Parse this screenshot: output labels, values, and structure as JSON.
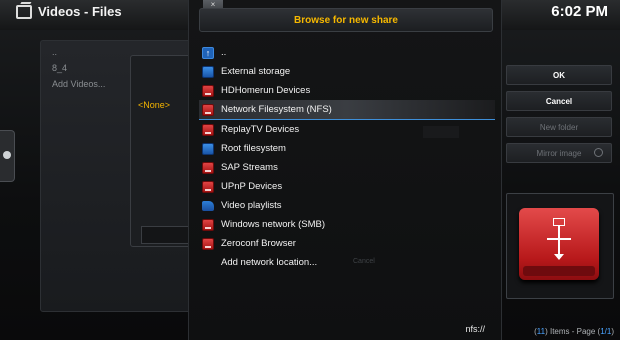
{
  "window": {
    "title": "Videos - Files",
    "clock": "6:02 PM"
  },
  "background_list": {
    "items": [
      "..",
      "8_4",
      "Add Videos..."
    ],
    "selected_value": "<None>"
  },
  "dialog": {
    "close_glyph": "×",
    "title": "Browse for new share",
    "items": [
      {
        "label": "..",
        "icon": "up-arrow-icon"
      },
      {
        "label": "External storage",
        "icon": "hard-drive-blue-icon"
      },
      {
        "label": "HDHomerun Devices",
        "icon": "network-drive-icon"
      },
      {
        "label": "Network Filesystem (NFS)",
        "icon": "network-drive-icon",
        "selected": true
      },
      {
        "label": "ReplayTV Devices",
        "icon": "network-drive-icon"
      },
      {
        "label": "Root filesystem",
        "icon": "hard-drive-blue-icon"
      },
      {
        "label": "SAP Streams",
        "icon": "network-drive-icon"
      },
      {
        "label": "UPnP Devices",
        "icon": "network-drive-icon"
      },
      {
        "label": "Video playlists",
        "icon": "folder-icon"
      },
      {
        "label": "Windows network (SMB)",
        "icon": "network-drive-icon"
      },
      {
        "label": "Zeroconf Browser",
        "icon": "network-drive-icon"
      },
      {
        "label": "Add network location...",
        "icon": ""
      }
    ],
    "path": "nfs://",
    "ghost_cancel": "Cancel"
  },
  "buttons": {
    "ok": "OK",
    "cancel": "Cancel",
    "new_folder": "New folder",
    "mirror_image": "Mirror image"
  },
  "status": {
    "items_open": "(",
    "items_count": "11",
    "items_text": ") Items - Page (",
    "page": "1/1",
    "close": ")"
  },
  "colors": {
    "accent": "#f6b800",
    "highlight": "#3e8fd9",
    "drive_red": "#c62022"
  }
}
